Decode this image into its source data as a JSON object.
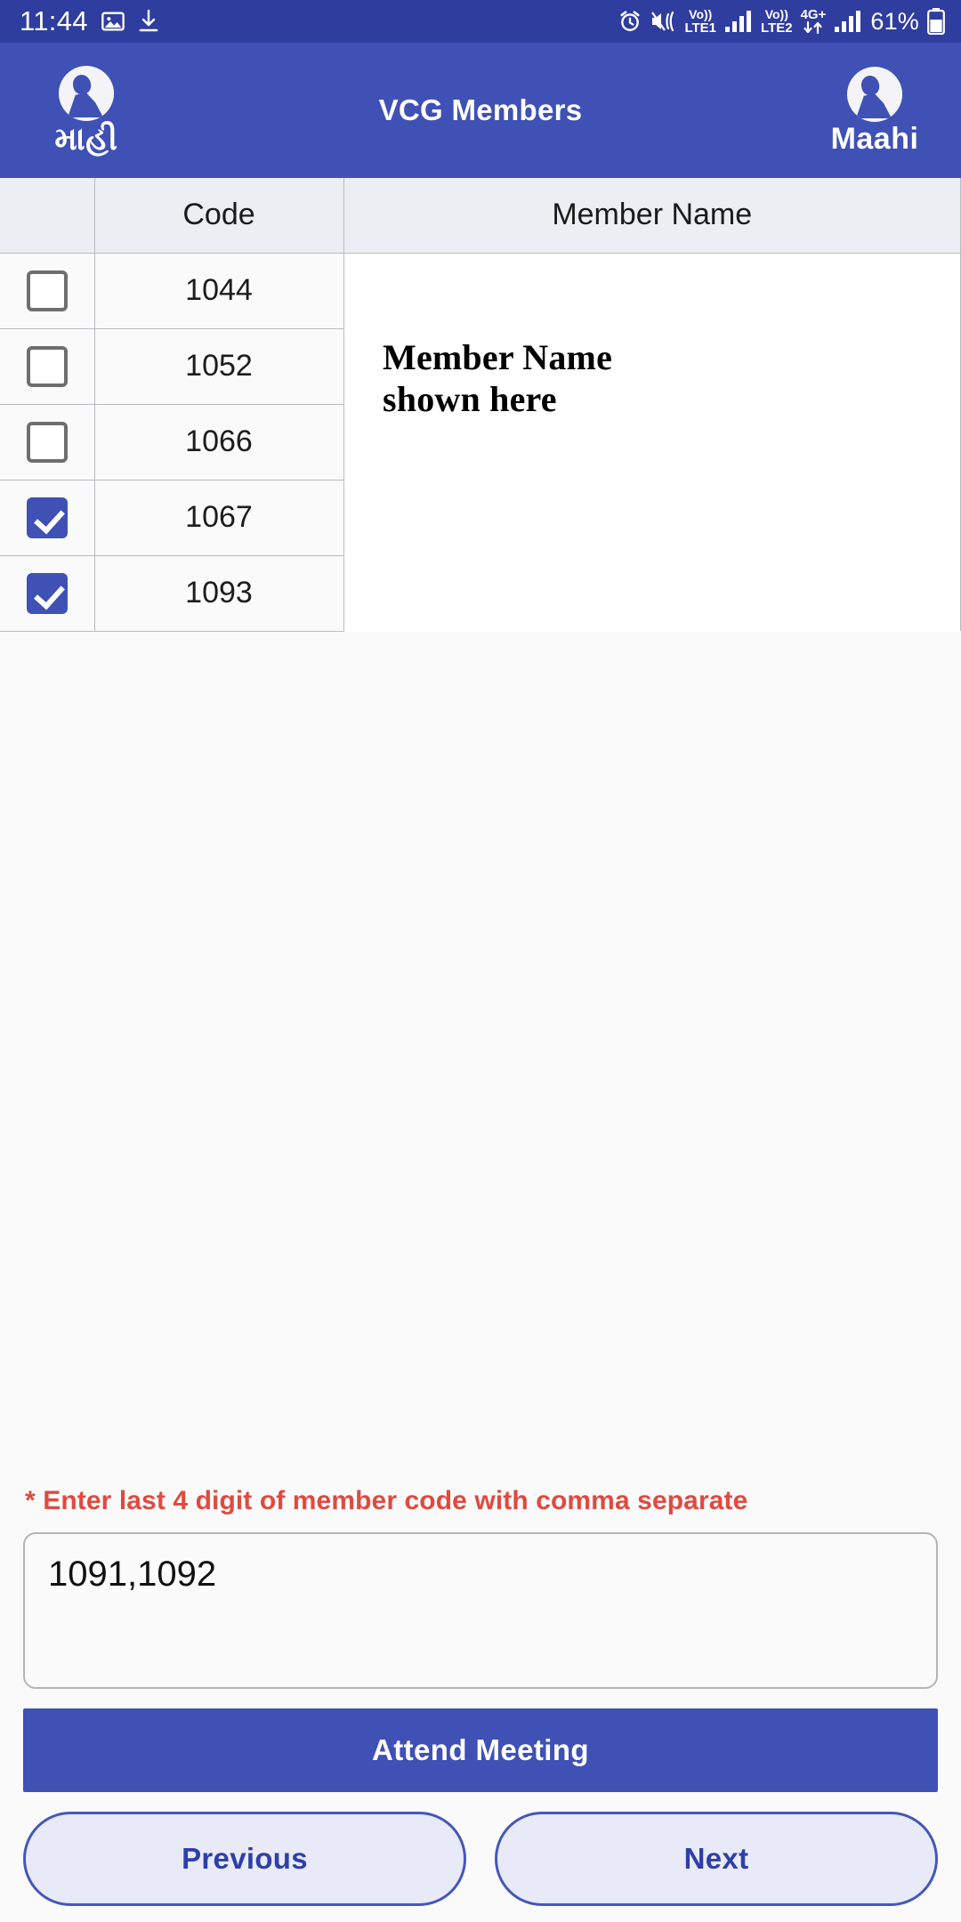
{
  "status_bar": {
    "time": "11:44",
    "left_icons": [
      "image-icon",
      "download-icon"
    ],
    "right_icons": [
      "alarm-icon",
      "mute-vibrate-icon"
    ],
    "sim1_label_top": "Vo))",
    "sim1_label_bottom": "LTE1",
    "sim2_label_top": "Vo))",
    "sim2_label_bottom": "LTE2",
    "network_label": "4G+",
    "battery_percent": "61%"
  },
  "app_bar": {
    "title": "VCG Members",
    "left_logo_text": "માહી",
    "right_logo_text": "Maahi"
  },
  "table": {
    "headers": [
      "",
      "Code",
      "Member Name"
    ],
    "name_cell_note": "Member Name\nshown here",
    "rows": [
      {
        "checked": false,
        "code": "1044"
      },
      {
        "checked": false,
        "code": "1052"
      },
      {
        "checked": false,
        "code": "1066"
      },
      {
        "checked": true,
        "code": "1067"
      },
      {
        "checked": true,
        "code": "1093"
      }
    ]
  },
  "form": {
    "hint": "* Enter last 4 digit of member code with comma separate",
    "code_input_value": "1091,1092",
    "code_input_placeholder": "",
    "attend_label": "Attend Meeting",
    "previous_label": "Previous",
    "next_label": "Next"
  },
  "colors": {
    "status_bar": "#2f3d9e",
    "app_bar": "#3f51b5",
    "accent": "#3f51b5",
    "hint_red": "#e04a3f",
    "nav_btn_fill": "#e8eaf8",
    "nav_btn_text": "#2f3fa8"
  }
}
